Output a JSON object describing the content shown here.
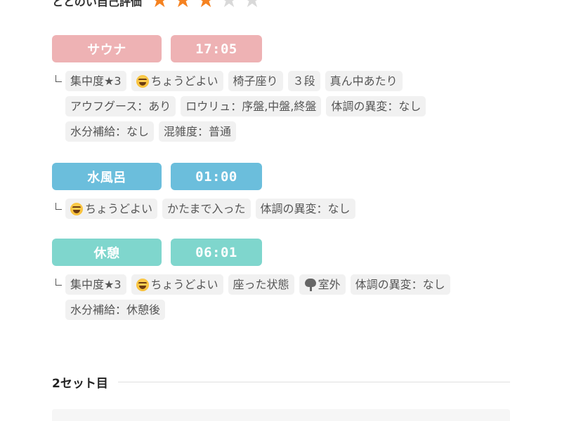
{
  "rating": {
    "label": "ととのい自己評価",
    "value": 3,
    "max": 5
  },
  "colors": {
    "sauna": "#eeb2b4",
    "water": "#6bbedc",
    "rest": "#7fd6cd",
    "star_on": "#f58220",
    "star_off": "#d9d9d9"
  },
  "sections": {
    "sauna": {
      "label": "サウナ",
      "time": "17:05",
      "tags": {
        "t0": "集中度★3",
        "t1": "ちょうどよい",
        "t2": "椅子座り",
        "t3": "３段",
        "t4": "真ん中あたり",
        "t5": "アウフグース：あり",
        "t6": "ロウリュ：序盤,中盤,終盤",
        "t7": "体調の異変：なし",
        "t8": "水分補給：なし",
        "t9": "混雑度：普通"
      }
    },
    "water": {
      "label": "水風呂",
      "time": "01:00",
      "tags": {
        "t0": "ちょうどよい",
        "t1": "かたまで入った",
        "t2": "体調の異変：なし"
      }
    },
    "rest": {
      "label": "休憩",
      "time": "06:01",
      "tags": {
        "t0": "集中度★3",
        "t1": "ちょうどよい",
        "t2": "座った状態",
        "t3": "室外",
        "t4": "体調の異変：なし",
        "t5": "水分補給：休憩後"
      }
    }
  },
  "set2": {
    "title": "2セット目"
  },
  "icons": {
    "mood": "grinning-squinting-face-icon",
    "outdoor": "tree-icon",
    "star": "star-icon",
    "branch": "branch-connector-icon"
  }
}
